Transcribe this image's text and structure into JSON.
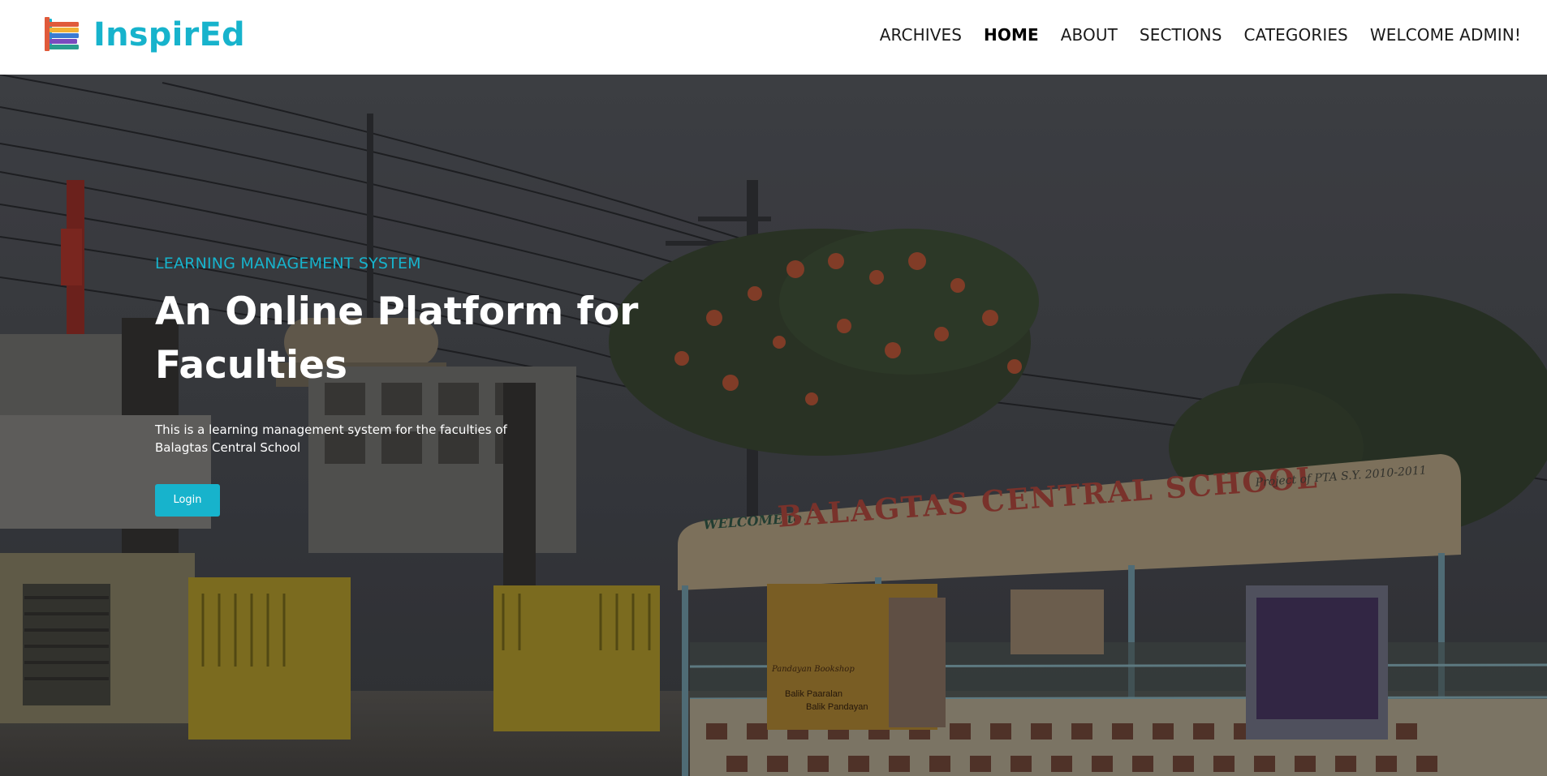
{
  "brand": {
    "name": "InspirEd",
    "icon": "books-stack-icon",
    "color": "#17b3cc"
  },
  "nav": [
    {
      "label": "ARCHIVES"
    },
    {
      "label": "HOME",
      "active": true
    },
    {
      "label": "ABOUT"
    },
    {
      "label": "SECTIONS"
    },
    {
      "label": "CATEGORIES"
    },
    {
      "label": "WELCOME ADMIN!"
    }
  ],
  "hero": {
    "eyebrow": "LEARNING MANAGEMENT SYSTEM",
    "headline": "An Online Platform for Faculties",
    "description": "This is a learning management system for the faculties of Balagtas Central School",
    "login_label": "Login",
    "sign": {
      "welcome": "WELCOME to",
      "school": "BALAGTAS CENTRAL SCHOOL",
      "project": "Project of PTA S.Y. 2010-2011"
    },
    "banner": {
      "title": "Pandayan Bookshop",
      "line1": "Balik Paaralan",
      "line2": "Balik Pandayan"
    }
  },
  "colors": {
    "accent": "#17b3cc",
    "header_bg": "#ffffff",
    "hero_text": "#ffffff"
  }
}
